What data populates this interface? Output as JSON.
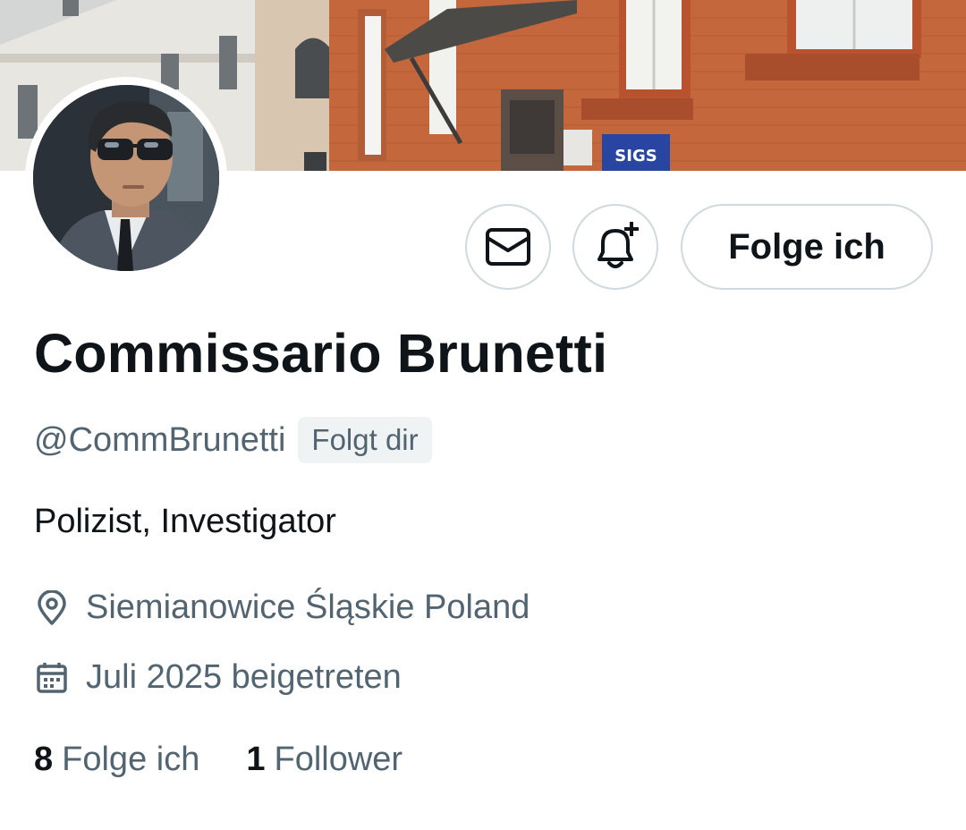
{
  "profile": {
    "display_name": "Commissario Brunetti",
    "handle": "@CommBrunetti",
    "follows_you_badge": "Folgt dir",
    "bio": "Polizist, Investigator",
    "location": "Siemianowice Śląskie Poland",
    "joined": "Juli 2025 beigetreten"
  },
  "actions": {
    "message_icon": "envelope-icon",
    "notify_icon": "bell-plus-icon",
    "follow_label": "Folge ich"
  },
  "stats": {
    "following_count": "8",
    "following_label": "Folge ich",
    "followers_count": "1",
    "followers_label": "Follower"
  },
  "banner": {
    "sign_text": "SIGS"
  },
  "colors": {
    "text_primary": "#0f1419",
    "text_secondary": "#536471",
    "border": "#cfd9de",
    "badge_bg": "#eff3f4"
  }
}
